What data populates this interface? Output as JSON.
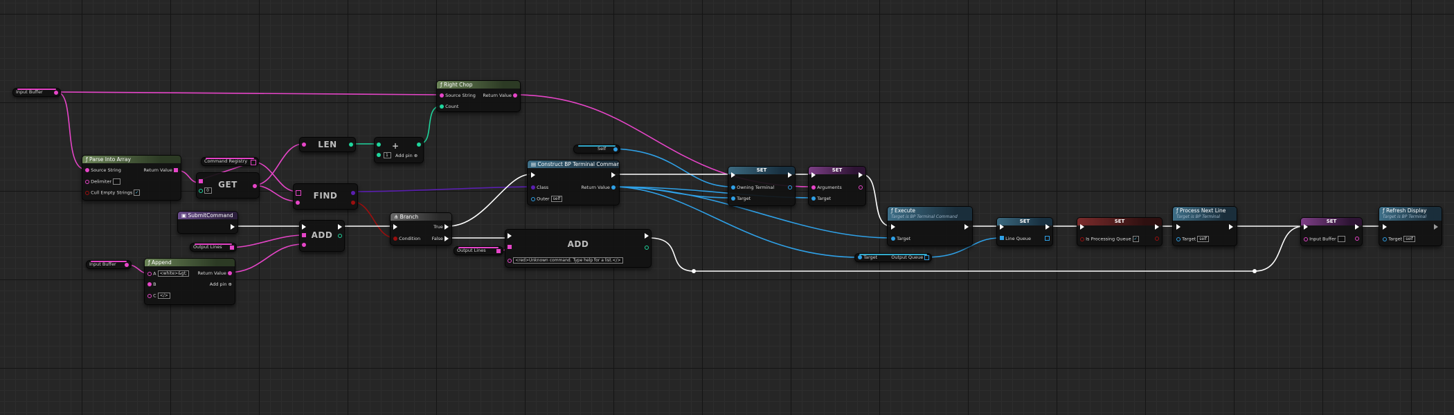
{
  "graph": {
    "input_buffer_var": "Input Buffer",
    "right_chop": {
      "title": "Right Chop",
      "source_string": "Source String",
      "count": "Count",
      "return_value": "Return Value"
    },
    "parse_into_array": {
      "title": "Parse Into Array",
      "source_string": "Source String",
      "delimiter": "Delimiter",
      "cull_empty": "Cull Empty Strings",
      "return_value": "Return Value",
      "check": "✓"
    },
    "command_registry_var": "Command Registry",
    "get": {
      "title": "GET",
      "index": "0"
    },
    "len": {
      "title": "LEN"
    },
    "add_int": {
      "symbol": "+",
      "value": "1",
      "add_pin": "Add pin"
    },
    "find": {
      "title": "FIND"
    },
    "submit_command": "SubmitCommand",
    "output_lines_var": "Output Lines",
    "add_main": {
      "title": "ADD"
    },
    "input_buffer_var2": "Input Buffer",
    "append": {
      "title": "Append",
      "a": "A",
      "a_value": "<white>&gt;",
      "b": "B",
      "c": "C",
      "c_value": "</>",
      "return_value": "Return Value",
      "add_pin": "Add pin"
    },
    "branch": {
      "title": "Branch",
      "condition": "Condition",
      "true_label": "True",
      "false_label": "False"
    },
    "output_lines_var2": "Output Lines",
    "add_unknown": {
      "title": "ADD",
      "text": "<red>Unknown command. Type help for a list.</>"
    },
    "self_var": "Self",
    "construct": {
      "title": "Construct BP Terminal Command",
      "class": "Class",
      "outer": "Outer",
      "outer_value": "self",
      "return_value": "Return Value"
    },
    "set1": {
      "title": "SET",
      "owning_terminal": "Owning Terminal",
      "target": "Target"
    },
    "set2": {
      "title": "SET",
      "arguments": "Arguments",
      "target": "Target"
    },
    "execute": {
      "title": "Execute",
      "subtitle": "Target is BP Terminal Command",
      "target": "Target"
    },
    "target_getter": {
      "target": "Target",
      "output_queue": "Output Queue"
    },
    "set_line_queue": {
      "title": "SET",
      "line_queue": "Line Queue"
    },
    "set_processing": {
      "title": "SET",
      "is_processing": "Is Processing Queue",
      "check": "✓"
    },
    "process_next_line": {
      "title": "Process Next Line",
      "subtitle": "Target is BP Terminal",
      "target": "Target",
      "target_value": "self"
    },
    "set_input_buffer": {
      "title": "SET",
      "input_buffer": "Input Buffer"
    },
    "refresh_display": {
      "title": "Refresh Display",
      "subtitle": "Target is BP Terminal",
      "target": "Target",
      "target_value": "self"
    }
  },
  "colors": {
    "exec": "#ffffff",
    "string": "#e645c8",
    "object": "#2fa0e6",
    "integer": "#1fd69d",
    "class": "#5a1fb0",
    "bool": "#9a0f0f",
    "array": "#e645c8"
  }
}
